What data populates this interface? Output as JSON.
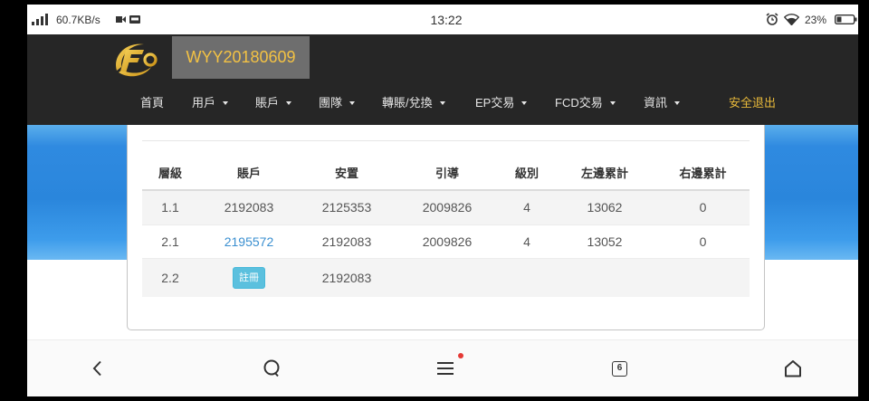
{
  "status_bar": {
    "net_speed": "60.7KB/s",
    "time": "13:22",
    "battery_level": "23%",
    "icons": [
      "signal-icon",
      "video-icon",
      "message-icon",
      "alarm-icon",
      "wifi-icon",
      "battery-icon"
    ]
  },
  "header": {
    "logo_icon": "fc-logo-icon",
    "username": "WYY20180609",
    "nav": [
      {
        "label": "首頁"
      },
      {
        "label": "用戶",
        "icon": "caret-down-icon"
      },
      {
        "label": "賬戶",
        "icon": "caret-down-icon"
      },
      {
        "label": "團隊",
        "icon": "caret-down-icon"
      },
      {
        "label": "轉賬/兌換",
        "icon": "caret-down-icon"
      },
      {
        "label": "EP交易",
        "icon": "caret-down-icon"
      },
      {
        "label": "FCD交易",
        "icon": "caret-down-icon"
      },
      {
        "label": "資訊",
        "icon": "caret-down-icon"
      },
      {
        "label": "安全退出"
      }
    ]
  },
  "network_table": {
    "columns": [
      "層級",
      "賬戶",
      "安置",
      "引導",
      "級別",
      "左邊累計",
      "右邊累計"
    ],
    "rows": [
      {
        "level": "1.1",
        "account": "2192083",
        "placement": "2125353",
        "referrer": "2009826",
        "rank": "4",
        "left_total": "13062",
        "right_total": "0"
      },
      {
        "level": "2.1",
        "account": "2195572",
        "placement": "2192083",
        "referrer": "2009826",
        "rank": "4",
        "left_total": "13052",
        "right_total": "0"
      },
      {
        "level": "2.2",
        "register_button": "註冊",
        "placement": "2192083"
      }
    ]
  },
  "bottom_nav": {
    "icons": [
      "back-icon",
      "search-icon",
      "menu-icon",
      "tabs-icon",
      "home-icon"
    ],
    "tabs_count": "6"
  },
  "colors": {
    "header_bg": "#262626",
    "username_box_bg": "#6e6e6e",
    "username_text": "#f3c244",
    "logout_text": "#e8b93a",
    "link_text": "#3a8fd0",
    "register_button_bg": "#5bc0de",
    "notification_dot": "#e53935"
  }
}
